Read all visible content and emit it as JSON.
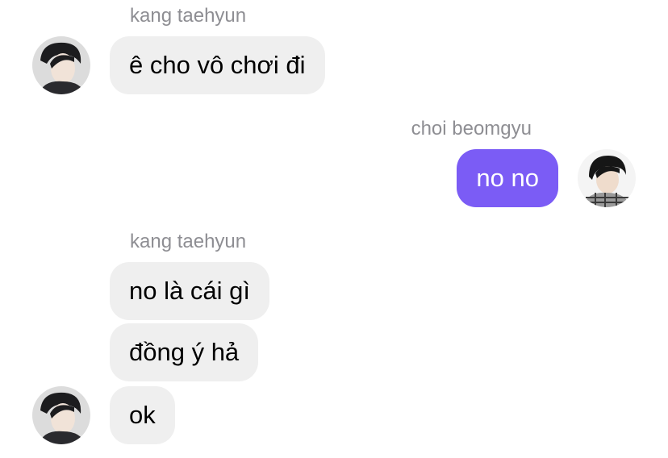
{
  "messages": [
    {
      "sender": "kang taehyun",
      "text": "ê cho vô chơi đi",
      "direction": "incoming"
    },
    {
      "sender": "choi beomgyu",
      "text": "no no",
      "direction": "outgoing"
    },
    {
      "sender": "kang taehyun",
      "text": "no là cái gì",
      "direction": "incoming"
    },
    {
      "text": "đồng ý hả",
      "direction": "incoming"
    },
    {
      "text": "ok",
      "direction": "incoming"
    }
  ],
  "colors": {
    "incoming_bubble": "#efefef",
    "outgoing_bubble": "#7b5cf5",
    "sender_name": "#8e8e93"
  },
  "icons": {
    "incoming_avatar": "avatar-photo-kang-taehyun",
    "outgoing_avatar": "avatar-photo-choi-beomgyu"
  }
}
